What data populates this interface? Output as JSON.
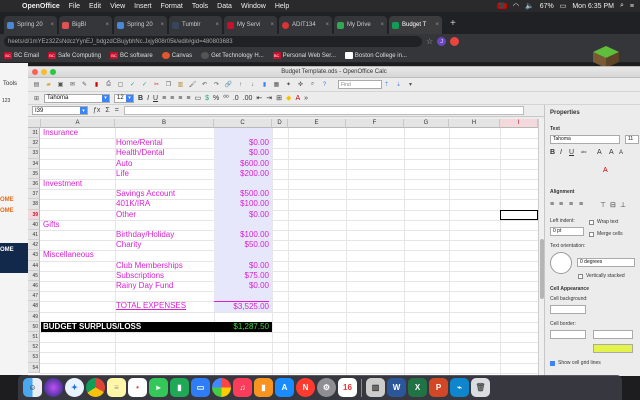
{
  "menubar": {
    "app_name": "OpenOffice",
    "items": [
      "File",
      "Edit",
      "View",
      "Insert",
      "Format",
      "Tools",
      "Data",
      "Window",
      "Help"
    ],
    "battery": "67%",
    "clock": "Mon 6:35 PM"
  },
  "browser": {
    "tabs": [
      {
        "label": "Spring 20",
        "color": "#4a88d6"
      },
      {
        "label": "BigBl",
        "color": "#e05353"
      },
      {
        "label": "Spring 20",
        "color": "#4a88d6"
      },
      {
        "label": "Tumblr",
        "color": "#36465d"
      },
      {
        "label": "My Servi",
        "color": "#c8102e"
      },
      {
        "label": "ADIT134",
        "color": "#d33"
      },
      {
        "label": "My Drive",
        "color": "#2fa84f"
      },
      {
        "label": "Budget T",
        "color": "#0f9d58"
      }
    ],
    "url": "heets/d/1mYEz32ZsNdczYynEJ_bdgzdCBujybhNc.Jxjy808r05k/edit#gid=480803683",
    "avatar_letter": "J",
    "bookmarks": [
      {
        "label": "BC Email",
        "icon": "BC"
      },
      {
        "label": "Safe Computing",
        "icon": "BC"
      },
      {
        "label": "BC software",
        "icon": "BC"
      },
      {
        "label": "Canvas",
        "icon": "canvas-icon"
      },
      {
        "label": "Get Technology H...",
        "icon": "globe-icon"
      },
      {
        "label": "Personal Web Ser...",
        "icon": "BC"
      },
      {
        "label": "Boston College in...",
        "icon": "doc-icon"
      }
    ],
    "bg_page": {
      "tools_label": "Tools",
      "zoom": "123",
      "ome_1": "OME",
      "ome_2": "OME",
      "ome_3": "OME"
    }
  },
  "calc": {
    "title": "Budget Template.ods - OpenOffice Calc",
    "find_placeholder": "Find",
    "font_name": "Tahoma",
    "font_size": "12",
    "name_box": "I39",
    "columns": [
      "A",
      "B",
      "C",
      "D",
      "E",
      "F",
      "G",
      "H",
      "I"
    ],
    "rows": [
      {
        "num": "31",
        "a": "Insurance",
        "b": "",
        "c": ""
      },
      {
        "num": "32",
        "a": "",
        "b": "Home/Rental",
        "c": "$0.00"
      },
      {
        "num": "33",
        "a": "",
        "b": "Health/Dental",
        "c": "$0.00"
      },
      {
        "num": "34",
        "a": "",
        "b": "Auto",
        "c": "$600.00"
      },
      {
        "num": "35",
        "a": "",
        "b": "Life",
        "c": "$200.00"
      },
      {
        "num": "36",
        "a": "Investment",
        "b": "",
        "c": ""
      },
      {
        "num": "37",
        "a": "",
        "b": "Savings Account",
        "c": "$500.00"
      },
      {
        "num": "38",
        "a": "",
        "b": "401K/IRA",
        "c": "$100.00"
      },
      {
        "num": "39",
        "a": "",
        "b": "Other",
        "c": "$0.00"
      },
      {
        "num": "40",
        "a": "Gifts",
        "b": "",
        "c": ""
      },
      {
        "num": "41",
        "a": "",
        "b": "Birthday/Holiday",
        "c": "$100.00"
      },
      {
        "num": "42",
        "a": "",
        "b": "Charity",
        "c": "$50.00"
      },
      {
        "num": "43",
        "a": "Miscellaneous",
        "b": "",
        "c": ""
      },
      {
        "num": "44",
        "a": "",
        "b": "Club Memberships",
        "c": "$0.00"
      },
      {
        "num": "45",
        "a": "",
        "b": "Subscriptions",
        "c": "$75.00"
      },
      {
        "num": "46",
        "a": "",
        "b": "Rainy Day Fund",
        "c": "$0.00"
      },
      {
        "num": "47",
        "a": "",
        "b": "",
        "c": ""
      },
      {
        "num": "48",
        "a": "",
        "b": "TOTAL EXPENSES",
        "c": "$3,525.00"
      },
      {
        "num": "49",
        "a": "",
        "b": "",
        "c": ""
      },
      {
        "num": "50",
        "a": "BUDGET SURPLUS/LOSS",
        "b": "",
        "c": "$1,287.50"
      },
      {
        "num": "51",
        "a": "",
        "b": "",
        "c": ""
      },
      {
        "num": "52",
        "a": "",
        "b": "",
        "c": ""
      },
      {
        "num": "53",
        "a": "",
        "b": "",
        "c": ""
      },
      {
        "num": "54",
        "a": "",
        "b": "",
        "c": ""
      }
    ],
    "selected_row": "39"
  },
  "sidebar": {
    "title": "Properties",
    "text_section": "Text",
    "font_name": "Tahoma",
    "font_size": "11",
    "alignment_section": "Alignment",
    "left_indent_label": "Left indent:",
    "left_indent_value": "0 pt",
    "wrap_text": "Wrap text",
    "merge_cells": "Merge cells",
    "orientation_label": "Text orientation:",
    "degrees_value": "0 degrees",
    "vertically_stacked": "Vertically stacked",
    "cell_appearance_section": "Cell Appearance",
    "cell_background_label": "Cell background:",
    "cell_border_label": "Cell border:",
    "show_grid_lines": "Show cell grid lines"
  },
  "dock": [
    "finder",
    "siri",
    "safari",
    "chrome",
    "notes",
    "reminders",
    "facetime",
    "numbers",
    "keynote",
    "photos",
    "music",
    "books",
    "appstore",
    "news",
    "settings",
    "calendar",
    "preview",
    "word",
    "excel",
    "powerpoint",
    "openoffice",
    "trash"
  ]
}
